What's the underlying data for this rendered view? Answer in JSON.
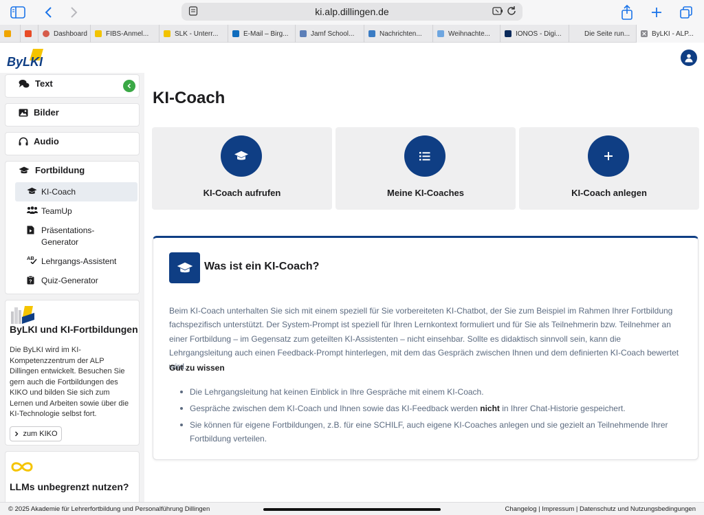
{
  "browser": {
    "url": "ki.alp.dillingen.de",
    "tabs": [
      {
        "label": "",
        "color": "#f0a500"
      },
      {
        "label": "",
        "color": "#e84b26"
      },
      {
        "label": "Dashboard",
        "color": "#d65b4a"
      },
      {
        "label": "FIBS-Anmel...",
        "color": "#f2c300"
      },
      {
        "label": "SLK - Unterr...",
        "color": "#f2c300"
      },
      {
        "label": "E-Mail – Birg...",
        "color": "#0f6cbd"
      },
      {
        "label": "Jamf School...",
        "color": "#5c7fb8"
      },
      {
        "label": "Nachrichten...",
        "color": "#3b7cc4"
      },
      {
        "label": "Weihnachte...",
        "color": "#6ea6e0"
      },
      {
        "label": "IONOS - Digi...",
        "color": "#0b2a5b"
      },
      {
        "label": "Die Seite run...",
        "color": "#e9e9eb"
      },
      {
        "label": "ByLKI - ALP...",
        "color": "#888888"
      }
    ]
  },
  "header": {
    "logo": "ByLKI"
  },
  "sidebar": {
    "sections": {
      "text": "Text",
      "bilder": "Bilder",
      "audio": "Audio",
      "fortbildung": "Fortbildung"
    },
    "sub_items": {
      "ki_coach": "KI-Coach",
      "teamup": "TeamUp",
      "praesentation": "Präsentations-Generator",
      "lehrgang": "Lehrgangs-Assistent",
      "quiz": "Quiz-Generator"
    },
    "promo1": {
      "title": "ByLKI und KI-Fortbildungen",
      "text": "Die ByLKI wird im KI-Kompetenzzentrum der ALP Dillingen entwickelt. Besuchen Sie gern auch die Fortbildungen des KIKO und bilden Sie sich zum Lernen und Arbeiten sowie über die KI-Technologie selbst fort.",
      "button": "zum KIKO"
    },
    "promo2": {
      "title": "LLMs unbegrenzt nutzen?"
    }
  },
  "main": {
    "title": "KI-Coach",
    "actions": {
      "open": "KI-Coach aufrufen",
      "mine": "Meine KI-Coaches",
      "create": "KI-Coach anlegen"
    },
    "info": {
      "title": "Was ist ein KI-Coach?",
      "body": "Beim KI-Coach unterhalten Sie sich mit einem speziell für Sie vorbereiteten KI-Chatbot, der Sie zum Beispiel im Rahmen Ihrer Fortbildung fachspezifisch unterstützt. Der System-Prompt ist speziell für Ihren Lernkontext formuliert und für Sie als Teilnehmerin bzw. Teilnehmer an einer Fortbildung – im Gegensatz zum geteilten KI-Assistenten – nicht einsehbar. Sollte es didaktisch sinnvoll sein, kann die Lehrgangsleitung auch einen Feedback-Prompt hinterlegen, mit dem das Gespräch zwischen Ihnen und dem definierten KI-Coach bewertet wird.",
      "subtitle": "Gut zu wissen",
      "bullet1": "Die Lehrgangsleitung hat keinen Einblick in Ihre Gespräche mit einem KI-Coach.",
      "bullet2_pre": "Gespräche zwischen dem KI-Coach und Ihnen sowie das KI-Feedback werden ",
      "bullet2_bold": "nicht",
      "bullet2_post": " in Ihrer Chat-Historie gespeichert.",
      "bullet3": "Sie können für eigene Fortbildungen, z.B. für eine SCHILF, auch eigene KI-Coaches anlegen und sie gezielt an Teilnehmende Ihrer Fortbildung verteilen."
    }
  },
  "footer": {
    "left": "© 2025 Akademie für Lehrerfortbildung und Personalführung Dillingen",
    "right": "Changelog | Impressum | Datenschutz und Nutzungsbedingungen"
  },
  "colors": {
    "brand": "#0f3e84",
    "accent_green": "#3aa845",
    "logo_yellow": "#f5c400"
  }
}
